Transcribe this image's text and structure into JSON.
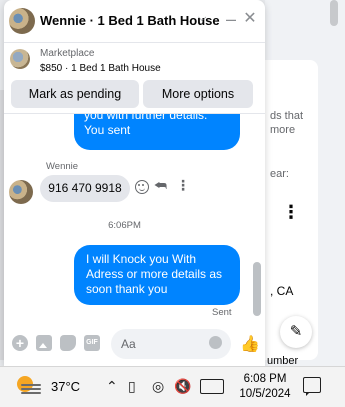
{
  "background": {
    "text_fragments": [
      "ds that",
      "more",
      "ear:"
    ],
    "location_fragment": ", CA",
    "number_fragment": "umber",
    "dots": "⋮"
  },
  "chat": {
    "title": "Wennie · 1 Bed 1 Bath House",
    "listing": {
      "source": "Marketplace",
      "title": "$850 · 1 Bed 1 Bath House",
      "buttons": {
        "mark_pending": "Mark as pending",
        "more_options": "More options"
      }
    },
    "messages": {
      "outgoing_1_lines": [
        "you with further details.",
        "You sent"
      ],
      "sender_name": "Wennie",
      "incoming_text": "916 470 9918",
      "timestamp": "6:06PM",
      "outgoing_2_text": "I will Knock you With Adress or more details  as soon thank you",
      "status": "Sent"
    },
    "composer": {
      "placeholder": "Aa",
      "gif_label": "GIF"
    }
  },
  "taskbar": {
    "temperature": "37°C",
    "time": "6:08 PM",
    "date": "10/5/2024"
  },
  "colors": {
    "messenger_blue": "#0084ff",
    "taskbar_bg": "#f3f3f3",
    "weather_sun": "#f5a623"
  },
  "icons": [
    "chevron-down-icon",
    "minimize-icon",
    "close-icon",
    "emoji-icon",
    "reply-icon",
    "more-icon",
    "plus-icon",
    "photo-icon",
    "sticker-icon",
    "gif-icon",
    "like-icon",
    "compose-icon",
    "weather-icon",
    "wifi-icon",
    "volume-icon",
    "keyboard-icon",
    "notification-icon"
  ]
}
